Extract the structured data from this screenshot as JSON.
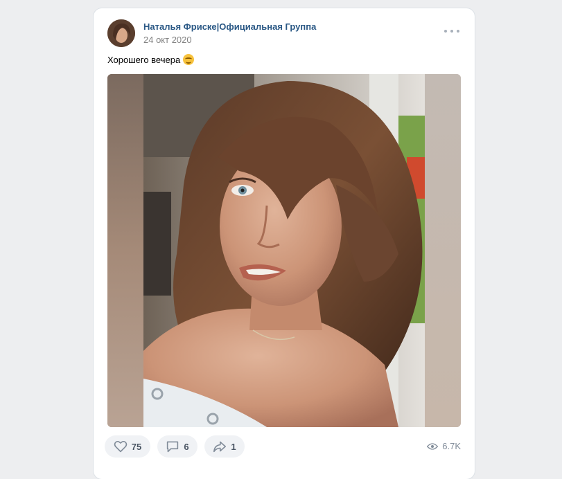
{
  "post": {
    "author": "Наталья Фриске|Официальная Группа",
    "date": "24 окт 2020",
    "text": "Хорошего вечера",
    "text_emoji": "smile-icon",
    "photo": "portrait-photo"
  },
  "actions": {
    "likes": "75",
    "comments": "6",
    "shares": "1",
    "views": "6.7K"
  },
  "icons": {
    "more": "more-dots-icon",
    "like": "heart-icon",
    "comment": "comment-icon",
    "share": "share-arrow-icon",
    "views": "eye-icon"
  },
  "colors": {
    "page_background": "#edeef0",
    "card_background": "#ffffff",
    "author_link": "#2a5885",
    "secondary_text": "#828282",
    "action_button_bg": "#f0f2f5",
    "action_icon": "#818c99"
  }
}
